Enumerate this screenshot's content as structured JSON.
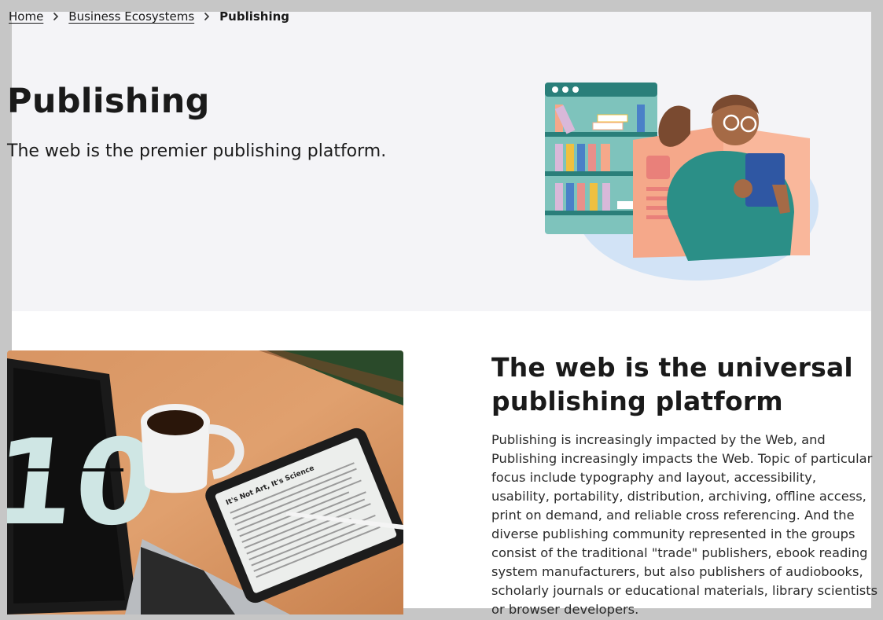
{
  "breadcrumb": {
    "home": "Home",
    "parent": "Business Ecosystems",
    "current": "Publishing"
  },
  "hero": {
    "title": "Publishing",
    "subtitle": "The web is the premier publishing platform."
  },
  "section": {
    "title": "The web is the universal publishing platform",
    "body": "Publishing is increasingly impacted by the Web, and Publishing increasingly impacts the Web. Topic of particular focus include typography and layout, accessibility, usability, portability, distribution, archiving, offline access, print on demand, and reliable cross referencing. And the diverse publishing community represented in the groups consist of the traditional \"trade\" publishers, ebook reading system manufacturers, but also publishers of audiobooks, scholarly journals or educational materials, library scientists or browser developers."
  },
  "photo": {
    "laptop_screen_number": "10",
    "tablet_heading": "It's Not Art, It's Science"
  },
  "icons": {
    "separator": "chevron-right-icon"
  },
  "colors": {
    "hero_background": "#f4f4f7",
    "frame_gray": "#c6c6c6",
    "text": "#1a1a1a",
    "shelf_teal": "#7ec3bc",
    "shelf_dark": "#2a7f7a",
    "book_peach": "#f5a88a",
    "sweater_teal": "#2b8f87",
    "tablet_blue": "#2f57a3"
  }
}
